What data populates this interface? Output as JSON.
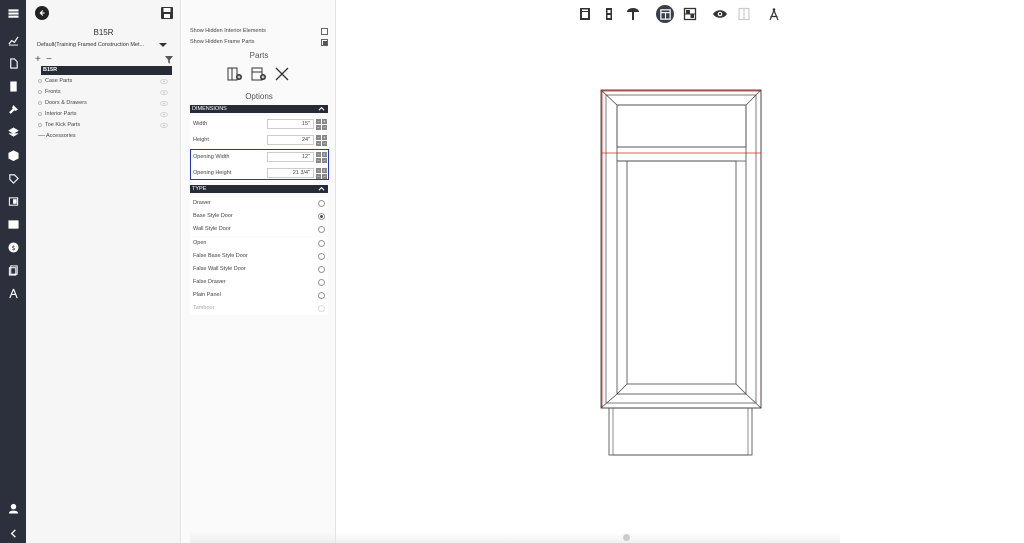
{
  "rail": {
    "icons": [
      "menu-icon",
      "chart-icon",
      "document-icon",
      "book-icon",
      "tools-icon",
      "layers-icon",
      "box-icon",
      "tag-icon",
      "door-icon",
      "grid-icon",
      "dollar-icon",
      "report-icon",
      "drafting-icon",
      "user-icon",
      "collapse-icon"
    ]
  },
  "tree": {
    "title": "B15R",
    "dropdown_value": "Default(Training Framed Construction Met...",
    "root_label": "B15R",
    "items": [
      {
        "label": "Case Parts"
      },
      {
        "label": "Fronts"
      },
      {
        "label": "Doors & Drawers"
      },
      {
        "label": "Interior Parts"
      },
      {
        "label": "Toe Kick Parts"
      },
      {
        "label": "Accessories"
      }
    ]
  },
  "props": {
    "show_hidden_interior": "Show Hidden Interior Elements",
    "show_hidden_interior_checked": false,
    "show_hidden_frame": "Show Hidden Frame Parts",
    "show_hidden_frame_checked": true,
    "parts_heading": "Parts",
    "options_heading": "Options",
    "dimensions_heading": "DIMENSIONS",
    "dimensions": [
      {
        "label": "Width",
        "value": "15\""
      },
      {
        "label": "Height",
        "value": "24\""
      },
      {
        "label": "Opening Width",
        "value": "12\""
      },
      {
        "label": "Opening Height",
        "value": "21 3/4\""
      }
    ],
    "type_heading": "TYPE",
    "types": [
      {
        "label": "Drawer",
        "selected": false,
        "disabled": false
      },
      {
        "label": "Base Style Door",
        "selected": true,
        "disabled": false
      },
      {
        "label": "Wall Style Door",
        "selected": false,
        "disabled": false
      },
      {
        "label": "Open",
        "selected": false,
        "disabled": false
      },
      {
        "label": "False Base Style Door",
        "selected": false,
        "disabled": false
      },
      {
        "label": "False Wall Style Door",
        "selected": false,
        "disabled": false
      },
      {
        "label": "False Drawer",
        "selected": false,
        "disabled": false
      },
      {
        "label": "Plain Panel",
        "selected": false,
        "disabled": false
      },
      {
        "label": "Tambour",
        "selected": false,
        "disabled": true
      }
    ]
  },
  "toolbar": {
    "icons": [
      "cabinet-front-icon",
      "cabinet-side-icon",
      "pull-icon",
      "frame-view-icon",
      "layout-icon",
      "visibility-icon",
      "panel-icon",
      "drafting-compass-icon"
    ],
    "active": "frame-view-icon"
  },
  "colors": {
    "rail_bg": "#2b303c",
    "header_bg": "#262b36",
    "highlight": "#2536c4",
    "drawing_red": "#e02020"
  }
}
